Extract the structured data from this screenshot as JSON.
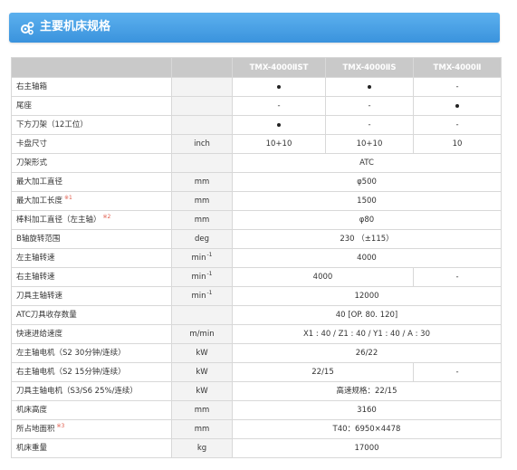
{
  "header": {
    "title": "主要机床规格"
  },
  "columns": [
    "",
    "",
    "TMX-4000ⅡST",
    "TMX-4000ⅡS",
    "TMX-4000Ⅱ"
  ],
  "rows": [
    {
      "label": "右主轴箱",
      "unit": "",
      "values": [
        "●",
        "●",
        "-"
      ]
    },
    {
      "label": "尾座",
      "unit": "",
      "values": [
        "-",
        "-",
        "●"
      ]
    },
    {
      "label": "下方刀架（12工位）",
      "unit": "",
      "values": [
        "●",
        "-",
        "-"
      ]
    },
    {
      "label": "卡盘尺寸",
      "unit": "inch",
      "values": [
        "10+10",
        "10+10",
        "10"
      ]
    },
    {
      "label": "刀架形式",
      "unit": "",
      "values": [
        "ATC"
      ]
    },
    {
      "label": "最大加工直径",
      "unit": "mm",
      "values": [
        "φ500"
      ]
    },
    {
      "label": "最大加工长度",
      "note": "※1",
      "unit": "mm",
      "values": [
        "1500"
      ]
    },
    {
      "label": "棒料加工直径（左主轴）",
      "note": "※2",
      "unit": "mm",
      "values": [
        "φ80"
      ]
    },
    {
      "label": "B轴旋转范围",
      "unit": "deg",
      "values": [
        "230 （±115）"
      ]
    },
    {
      "label": "左主轴转速",
      "unit": "min",
      "unit_sup": "-1",
      "values": [
        "4000"
      ]
    },
    {
      "label": "右主轴转速",
      "unit": "min",
      "unit_sup": "-1",
      "values": [
        "4000",
        "-"
      ]
    },
    {
      "label": "刀具主轴转速",
      "unit": "min",
      "unit_sup": "-1",
      "values": [
        "12000"
      ]
    },
    {
      "label": "ATC刀具收存数量",
      "unit": "",
      "values": [
        "40 [OP. 80. 120]"
      ]
    },
    {
      "label": "快速进给速度",
      "unit": "m/min",
      "values": [
        "X1 : 40 / Z1 : 40 / Y1 : 40 / A : 30"
      ]
    },
    {
      "label": "左主轴电机（S2 30分钟/连续）",
      "unit": "kW",
      "values": [
        "26/22"
      ]
    },
    {
      "label": "右主轴电机（S2 15分钟/连续）",
      "unit": "kW",
      "values": [
        "22/15",
        "-"
      ]
    },
    {
      "label": "刀具主轴电机（S3/S6 25%/连续）",
      "unit": "kW",
      "values": [
        "高速规格：22/15"
      ]
    },
    {
      "label": "机床高度",
      "unit": "mm",
      "values": [
        "3160"
      ]
    },
    {
      "label": "所占地面积",
      "note": "※3",
      "unit": "mm",
      "values": [
        "T40：6950×4478"
      ]
    },
    {
      "label": "机床重量",
      "unit": "kg",
      "values": [
        "17000"
      ]
    }
  ]
}
